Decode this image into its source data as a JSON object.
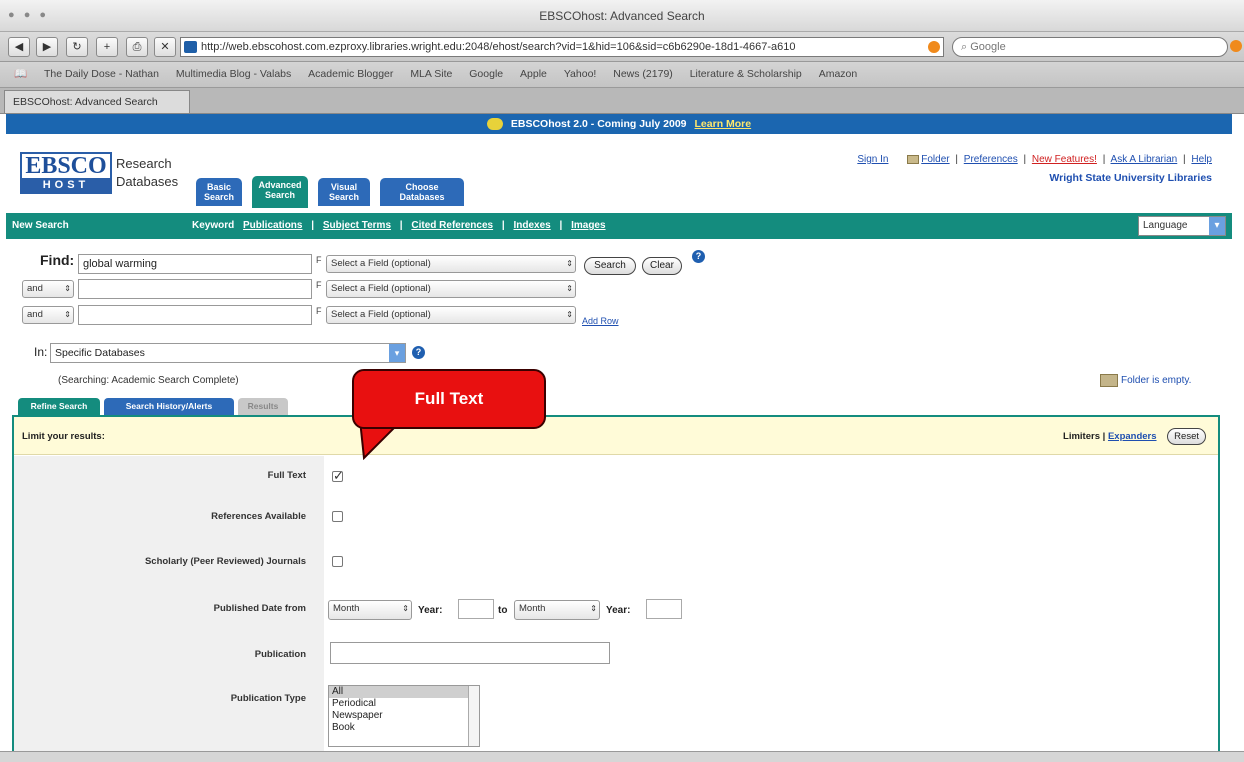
{
  "window": {
    "title": "EBSCOhost: Advanced Search"
  },
  "toolbar": {
    "url": "http://web.ebscohost.com.ezproxy.libraries.wright.edu:2048/ehost/search?vid=1&hid=106&sid=c6b6290e-18d1-4667-a610",
    "search_placeholder": "Google"
  },
  "bookmarks": [
    "The Daily Dose - Nathan",
    "Multimedia Blog - Valabs",
    "Academic Blogger",
    "MLA Site",
    "Google",
    "Apple",
    "Yahoo!",
    "News (2179)",
    "Literature & Scholarship",
    "Amazon"
  ],
  "tab": {
    "label": "EBSCOhost: Advanced Search"
  },
  "banner": {
    "text": "EBSCOhost 2.0 - Coming July 2009",
    "link": "Learn More"
  },
  "logo": {
    "top": "EBSCO",
    "bottom": "HOST",
    "line1": "Research",
    "line2": "Databases"
  },
  "nav_tabs": [
    {
      "line1": "Basic",
      "line2": "Search"
    },
    {
      "line1": "Advanced",
      "line2": "Search"
    },
    {
      "line1": "Visual",
      "line2": "Search"
    },
    {
      "line1": "Choose",
      "line2": "Databases"
    }
  ],
  "top_links": {
    "sign_in": "Sign In",
    "folder": "Folder",
    "preferences": "Preferences",
    "new_features": "New Features!",
    "ask_librarian": "Ask A Librarian",
    "help": "Help",
    "sep": "|"
  },
  "university": "Wright State University Libraries",
  "green_bar": {
    "new_search": "New Search",
    "links": [
      "Keyword",
      "Publications",
      "Subject Terms",
      "Cited References",
      "Indexes",
      "Images"
    ],
    "sep": "|",
    "language": "Language"
  },
  "find": {
    "label": "Find:",
    "rows": [
      {
        "value": "global warming",
        "operator": "",
        "field": "Select a Field (optional)"
      },
      {
        "value": "",
        "operator": "and",
        "field": "Select a Field (optional)"
      },
      {
        "value": "",
        "operator": "and",
        "field": "Select a Field (optional)"
      }
    ],
    "field_glyph": "F",
    "search_btn": "Search",
    "clear_btn": "Clear",
    "add_row": "Add Row",
    "help": "?"
  },
  "in": {
    "label": "In:",
    "value": "Specific Databases"
  },
  "searching_note": "(Searching: Academic Search Complete)",
  "folder_status": "Folder is empty.",
  "sub_tabs": [
    "Refine Search",
    "Search History/Alerts",
    "Results"
  ],
  "callout": {
    "text": "Full Text"
  },
  "limits": {
    "header": "Limit your results:",
    "right": {
      "limiters": "Limiters",
      "expanders": "Expanders",
      "reset": "Reset",
      "sep": "|"
    },
    "full_text": {
      "label": "Full Text",
      "checked": true
    },
    "references": {
      "label": "References Available",
      "checked": false
    },
    "scholarly": {
      "label": "Scholarly (Peer Reviewed) Journals",
      "checked": false
    },
    "pub_date": {
      "label": "Published Date from",
      "month1": "Month",
      "year1": "Year:",
      "to": "to",
      "month2": "Month",
      "year2": "Year:"
    },
    "publication": {
      "label": "Publication",
      "value": ""
    },
    "pub_type": {
      "label": "Publication Type",
      "options": [
        "All",
        "Periodical",
        "Newspaper",
        "Book"
      ]
    }
  }
}
